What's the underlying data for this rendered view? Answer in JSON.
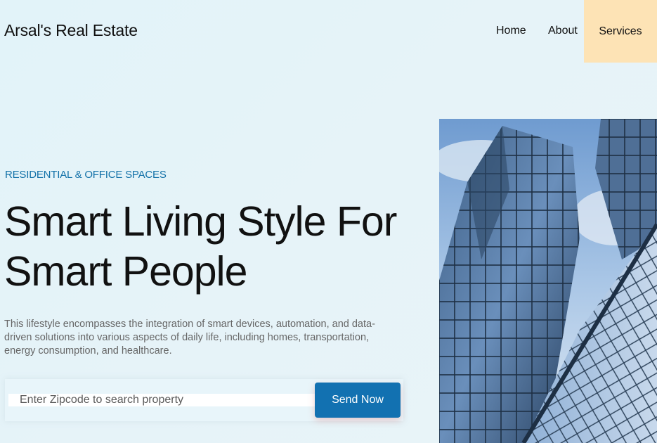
{
  "header": {
    "brand": "Arsal's Real Estate",
    "nav": {
      "home": "Home",
      "about": "About",
      "services": "Services"
    }
  },
  "hero": {
    "eyebrow": "RESIDENTIAL & OFFICE SPACES",
    "headline_line1": "Smart Living Style For",
    "headline_line2": "Smart People",
    "description": "This lifestyle encompasses the integration of smart devices, automation, and data-driven solutions into various aspects of daily life, including homes, transportation, energy consumption, and healthcare."
  },
  "search": {
    "placeholder": "Enter Zipcode to search property",
    "button_label": "Send Now"
  },
  "colors": {
    "accent": "#1271b1",
    "services_highlight": "#fde3b5"
  }
}
